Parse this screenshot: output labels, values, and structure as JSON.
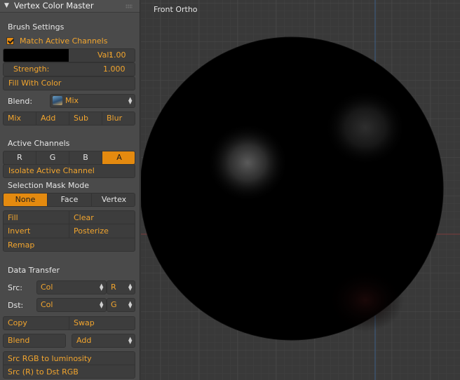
{
  "panel": {
    "title": "Vertex Color Master",
    "brush_settings": {
      "heading": "Brush Settings",
      "match_active_channels": "Match Active Channels",
      "val_label": "Val:",
      "val_value": "1.00",
      "strength_label": "Strength:",
      "strength_value": "1.000",
      "fill_with_color": "Fill With Color",
      "blend_label": "Blend:",
      "blend_value": "Mix",
      "blend_buttons": [
        "Mix",
        "Add",
        "Sub",
        "Blur"
      ]
    },
    "active_channels": {
      "heading": "Active Channels",
      "channels": [
        "R",
        "G",
        "B",
        "A"
      ],
      "active": "A",
      "isolate": "Isolate Active Channel"
    },
    "selection_mask": {
      "heading": "Selection Mask Mode",
      "modes": [
        "None",
        "Face",
        "Vertex"
      ],
      "active": "None"
    },
    "ops": {
      "fill": "Fill",
      "clear": "Clear",
      "invert": "Invert",
      "posterize": "Posterize",
      "remap": "Remap"
    },
    "data_transfer": {
      "heading": "Data Transfer",
      "src_label": "Src:",
      "src_layer": "Col",
      "src_channel": "R",
      "dst_label": "Dst:",
      "dst_layer": "Col",
      "dst_channel": "G",
      "copy": "Copy",
      "swap": "Swap",
      "blend": "Blend",
      "blend_mode": "Add",
      "rgb_to_luminosity": "Src RGB to luminosity",
      "src_to_dst": "Src (R) to Dst RGB"
    }
  },
  "viewport": {
    "label": "Front Ortho"
  },
  "colors": {
    "accent": "#e48a0f",
    "text_accent": "#f2a52e",
    "panel_bg": "#4a4a4a",
    "viewport_bg": "#393939"
  }
}
